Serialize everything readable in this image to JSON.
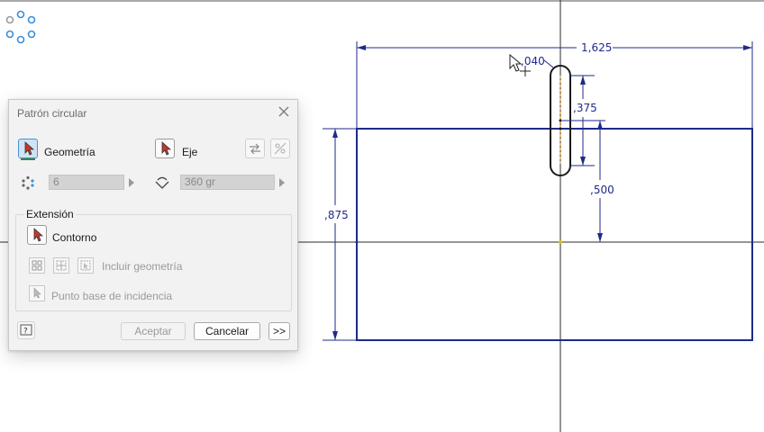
{
  "dialog": {
    "title": "Patrón circular",
    "geometry_label": "Geometría",
    "axis_label": "Eje",
    "count_value": "6",
    "angle_value": "360 gr",
    "extension_title": "Extensión",
    "contour_label": "Contorno",
    "include_geometry_label": "Incluir geometría",
    "base_point_label": "Punto base de incidencia",
    "accept_label": "Aceptar",
    "cancel_label": "Cancelar",
    "more_label": ">>"
  },
  "dimensions": {
    "width": "1,625",
    "slot_radius": ",040",
    "slot_top": ",375",
    "slot_offset": ",500",
    "height": ",875"
  },
  "colors": {
    "sketch_line": "#1f2a8a",
    "dialog_bg": "#f2f2f2",
    "accent": "#4a90d9"
  },
  "icons": {
    "app": "circular-pattern-icon",
    "close": "close-icon",
    "help": "help-icon"
  }
}
